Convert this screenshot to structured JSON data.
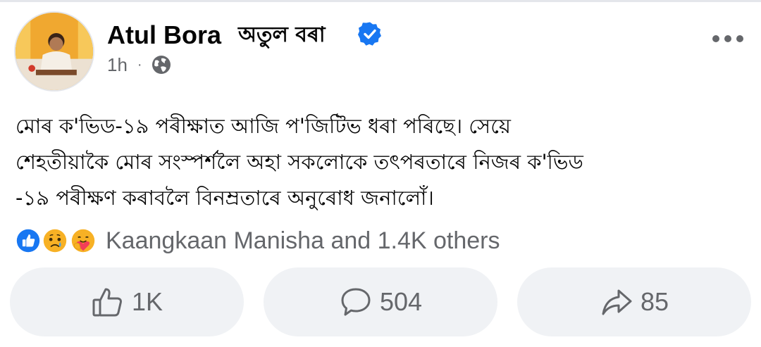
{
  "post": {
    "author": {
      "name": "Atul Bora",
      "name_alt": "অতুল বৰা",
      "verified": true
    },
    "time": "1h",
    "separator": "·",
    "privacy_icon": "globe-icon",
    "more_icon": "more-options-icon",
    "text_lines": [
      "মোৰ ক'ভিড-১৯ পৰীক্ষাত আজি প'জিটিভ ধৰা পৰিছে। সেয়ে",
      "শেহতীয়াকৈ মোৰ সংস্পৰ্শলৈ অহা সকলোকে তৎপৰতাৰে নিজৰ ক'ভিড",
      "-১৯ পৰীক্ষণ কৰাবলৈ বিনম্ৰতাৰে অনুৰোধ জনালোঁ।"
    ]
  },
  "reactions": {
    "icons": [
      "like-icon",
      "sad-icon",
      "care-icon"
    ],
    "summary": "Kaangkaan Manisha and 1.4K others"
  },
  "actions": {
    "like": {
      "icon": "thumbs-up-icon",
      "count": "1K"
    },
    "comment": {
      "icon": "comment-icon",
      "count": "504"
    },
    "share": {
      "icon": "share-icon",
      "count": "85"
    }
  },
  "colors": {
    "verified_blue": "#1877f2",
    "button_bg": "#f0f2f5",
    "muted_text": "#65676b",
    "like_blue": "#1877f2",
    "emoji_yellow": "#f7b125"
  }
}
